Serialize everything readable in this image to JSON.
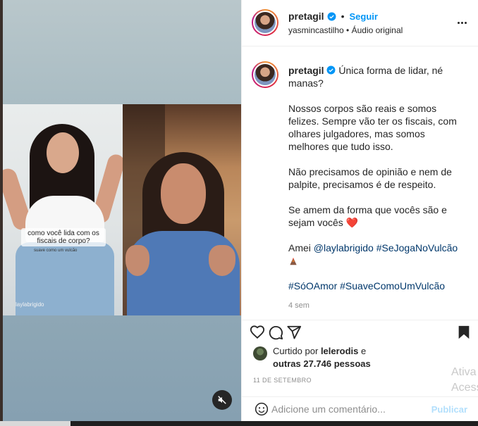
{
  "post": {
    "username": "pretagil",
    "follow_label": "Seguir",
    "audio_user": "yasmincastilho",
    "audio_label": "Áudio original"
  },
  "media": {
    "caption_line": "como você lida com os fiscais de corpo?",
    "caption_sub": "suave como um vulcão",
    "watermark": "laylabrigido"
  },
  "comment": {
    "username": "pretagil",
    "p1": "Única forma de lidar, né manas?",
    "p2": "Nossos corpos são reais e somos felizes. Sempre vão ter os fiscais, com olhares julgadores, mas somos melhores que tudo isso.",
    "p3": "Não precisamos de opinião e nem de palpite, precisamos é de respeito.",
    "p4": "Se amem da forma que vocês são e sejam vocês",
    "heart_emoji": "❤️",
    "amei": "Amei",
    "mention": "@laylabrigido",
    "tag1": "#SeJogaNoVulcão",
    "tag2": "#SóOAmor",
    "tag3": "#SuaveComoUmVulcão",
    "time": "4 sem"
  },
  "likes": {
    "prefix": "Curtido por",
    "user": "lelerodis",
    "connector": "e",
    "others": "outras 27.746 pessoas"
  },
  "date": "11 DE SETEMBRO",
  "add_comment": {
    "placeholder": "Adicione um comentário...",
    "publish_label": "Publicar"
  },
  "overlay": {
    "line1": "Ativa",
    "line2": "Acess"
  },
  "icons": {
    "header_more": "more-options-icon",
    "verified": "verified-badge-icon",
    "like": "heart-icon",
    "comment": "comment-icon",
    "share": "paper-plane-icon",
    "save": "bookmark-icon",
    "mute": "muted-speaker-icon",
    "emoji": "smiley-icon"
  },
  "colors": {
    "accent": "#0095f6",
    "link": "#00376b",
    "muted_text": "#8e8e8e",
    "publish_disabled": "#b2dffc"
  }
}
